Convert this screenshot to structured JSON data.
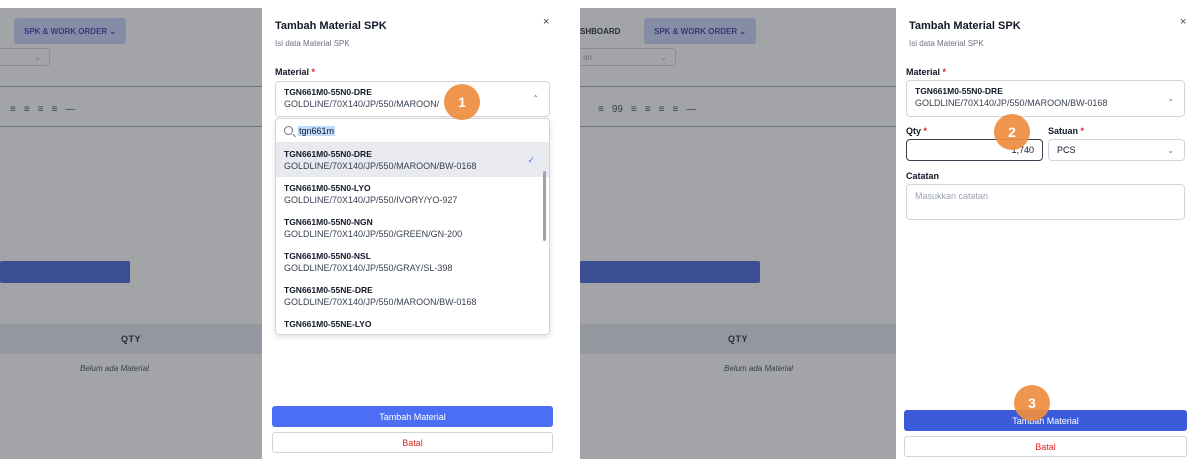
{
  "left": {
    "nav_label": "SPK & WORK ORDER ⌄",
    "table_header": "QTY",
    "empty_text": "Belum ada Material",
    "modal": {
      "title": "Tambah Material SPK",
      "subtitle": "Isi data Material SPK",
      "close": "×",
      "material_label": "Material",
      "required": "*",
      "selected_code": "TGN661M0-55N0-DRE",
      "selected_desc": "GOLDLINE/70X140/JP/550/MAROON/",
      "search_value": "tgn661m",
      "options": [
        {
          "code": "TGN661M0-55N0-DRE",
          "desc": "GOLDLINE/70X140/JP/550/MAROON/BW-0168"
        },
        {
          "code": "TGN661M0-55N0-LYO",
          "desc": "GOLDLINE/70X140/JP/550/IVORY/YO-927"
        },
        {
          "code": "TGN661M0-55N0-NGN",
          "desc": "GOLDLINE/70X140/JP/550/GREEN/GN-200"
        },
        {
          "code": "TGN661M0-55N0-NSL",
          "desc": "GOLDLINE/70X140/JP/550/GRAY/SL-398"
        },
        {
          "code": "TGN661M0-55NE-DRE",
          "desc": "GOLDLINE/70X140/JP/550/MAROON/BW-0168"
        },
        {
          "code": "TGN661M0-55NE-LYO",
          "desc": ""
        }
      ],
      "primary_button": "Tambah Material",
      "cancel_button": "Batal"
    },
    "marker": "1"
  },
  "right": {
    "nav_text": "SHBOARD",
    "nav_label": "SPK & WORK ORDER ⌄",
    "select_placeholder": "an",
    "table_header": "QTY",
    "empty_text": "Belum ada Material",
    "modal": {
      "title": "Tambah Material SPK",
      "subtitle": "Isi data Material SPK",
      "close": "×",
      "material_label": "Material",
      "required": "*",
      "selected_code": "TGN661M0-55N0-DRE",
      "selected_desc": "GOLDLINE/70X140/JP/550/MAROON/BW-0168",
      "qty_label": "Qty",
      "qty_value": "1,740",
      "unit_label": "Satuan",
      "unit_value": "PCS",
      "notes_label": "Catatan",
      "notes_placeholder": "Masukkan catatan",
      "primary_button": "Tambah Material",
      "cancel_button": "Batal"
    },
    "markers": [
      "2",
      "3"
    ]
  },
  "colors": {
    "primary": "#4c6ef5",
    "danger": "#dc2626",
    "marker": "#ee8d3e",
    "overlay": "#3c4048"
  }
}
